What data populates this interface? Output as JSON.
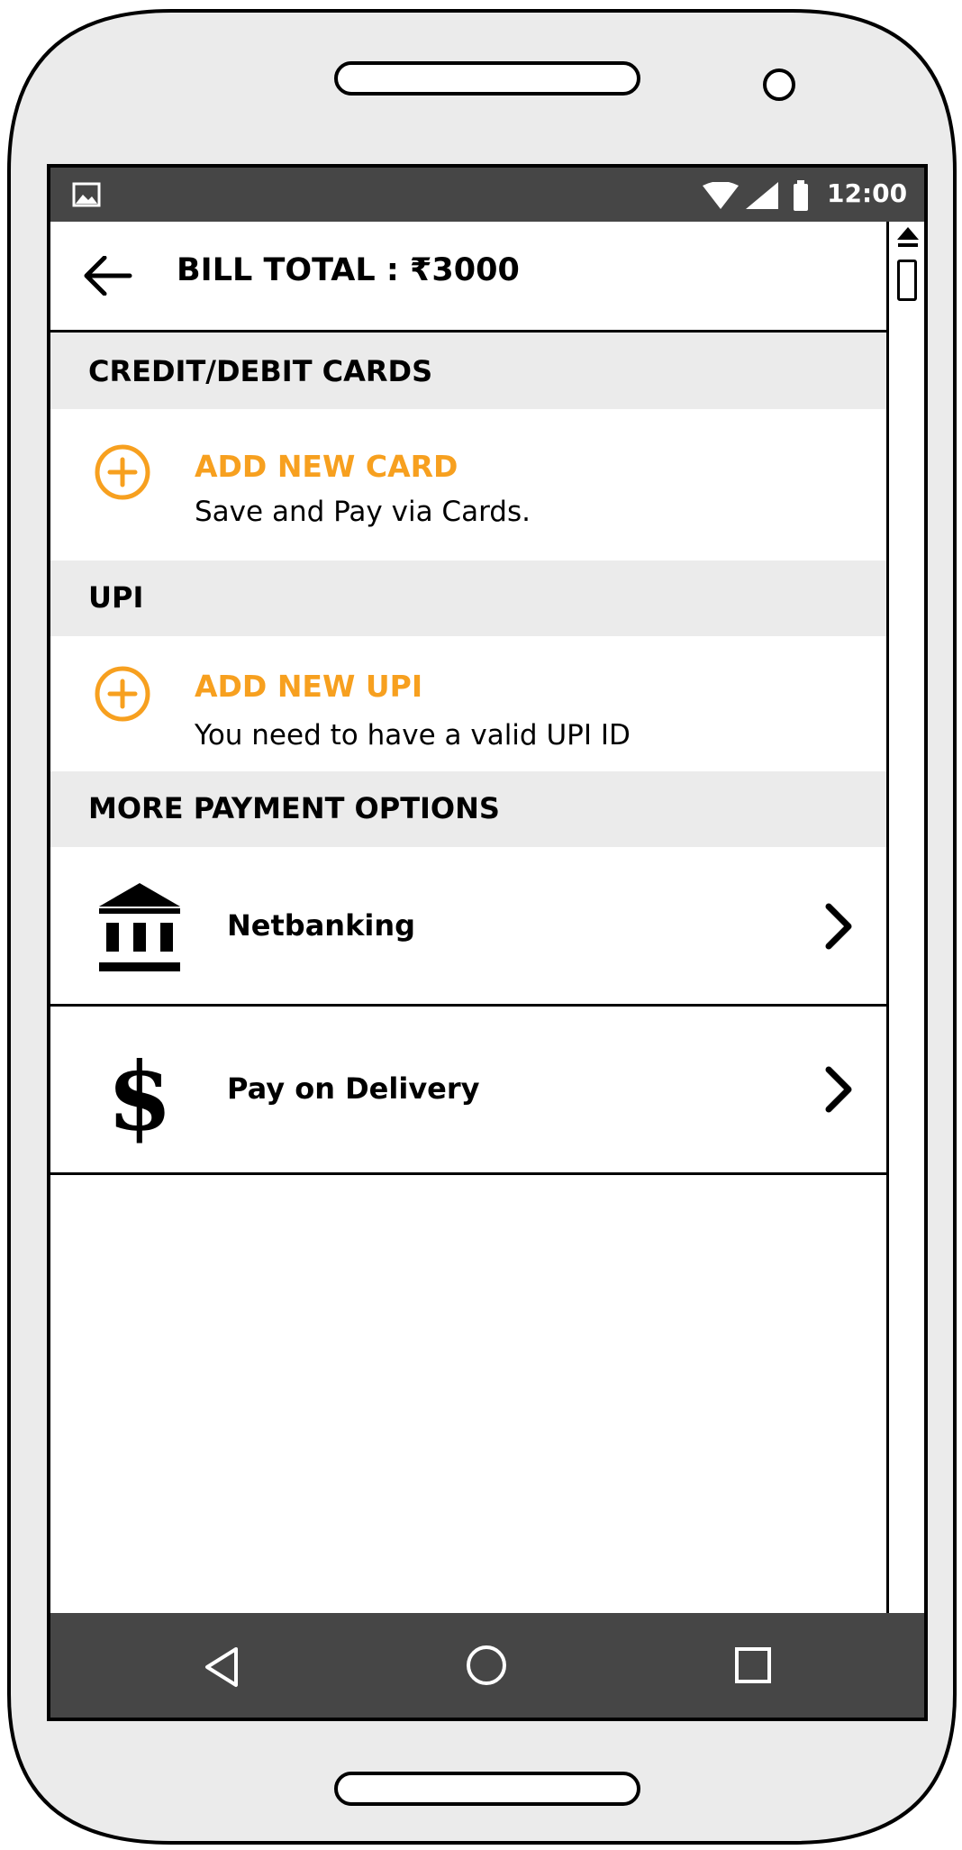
{
  "status_bar": {
    "time": "12:00"
  },
  "app_bar": {
    "title": "BILL TOTAL : ₹3000"
  },
  "sections": {
    "cards": {
      "header": "CREDIT/DEBIT CARDS",
      "add_title": "ADD NEW CARD",
      "add_subtitle": "Save and Pay via Cards."
    },
    "upi": {
      "header": "UPI",
      "add_title": "ADD NEW UPI",
      "add_subtitle": "You need to have a valid UPI ID"
    },
    "more": {
      "header": "MORE PAYMENT OPTIONS",
      "options": [
        {
          "label": "Netbanking",
          "icon": "bank-icon"
        },
        {
          "label": "Pay on Delivery",
          "icon": "dollar-icon"
        }
      ]
    }
  },
  "colors": {
    "accent": "#f7a01f",
    "bars": "#464646",
    "section_bg": "#ebebeb",
    "device_bg": "#ebebeb"
  },
  "nav": {
    "icons": [
      "back-triangle-icon",
      "home-circle-icon",
      "recents-square-icon"
    ]
  }
}
